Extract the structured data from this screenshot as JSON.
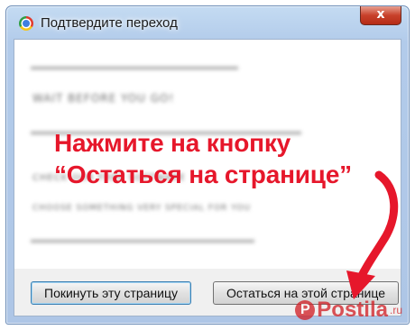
{
  "window": {
    "title": "Подтвердите переход",
    "close_label": "x"
  },
  "dialog": {
    "blurred_lines": [
      "WAIT BEFORE YOU GO!",
      "CHECK OUR FREE SOFTWARE",
      "CHOOSE SOMETHING VERY SPECIAL FOR YOU"
    ],
    "instruction_line1": "Нажмите на кнопку",
    "instruction_line2": "“Остаться на странице”"
  },
  "buttons": {
    "leave_label": "Покинуть эту страницу",
    "stay_label": "Остаться на этой странице"
  },
  "watermark": {
    "text": "Postila",
    "domain": ".ru"
  },
  "colors": {
    "instruction": "#e6172b",
    "arrow": "#e6172b",
    "watermark": "#d2242a"
  },
  "icons": [
    "chrome-icon",
    "close-icon",
    "arrow-icon"
  ]
}
